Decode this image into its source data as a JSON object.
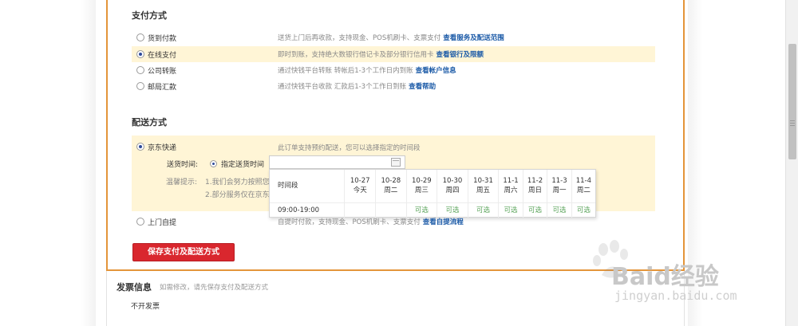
{
  "payment": {
    "title": "支付方式",
    "options": [
      {
        "label": "货到付款",
        "desc": "送货上门后再收款，支持现金、POS机刷卡、支票支付",
        "link": "查看服务及配送范围",
        "selected": false
      },
      {
        "label": "在线支付",
        "desc": "即时到账，支持绝大数银行借记卡及部分银行信用卡",
        "link": "查看银行及限额",
        "selected": true
      },
      {
        "label": "公司转账",
        "desc": "通过快钱平台转账 转帐后1-3个工作日内到账",
        "link": "查看帐户信息",
        "selected": false
      },
      {
        "label": "邮局汇款",
        "desc": "通过快钱平台收款 汇款后1-3个工作日到账",
        "link": "查看帮助",
        "selected": false
      }
    ]
  },
  "shipping": {
    "title": "配送方式",
    "jd": {
      "label": "京东快递",
      "desc": "此订单支持预约配送，您可以选择指定的时间段",
      "selected": true
    },
    "time_label": "送货时间:",
    "time_option": "指定送货时间",
    "tips_label": "温馨提示:",
    "tips": [
      "1.我们会努力按照您",
      "2.部分服务仅在京东"
    ],
    "pickup": {
      "label": "上门自提",
      "desc": "自提时付款，支持现金、POS机刷卡、支票支付",
      "link": "查看自提流程",
      "selected": false
    }
  },
  "calendar": {
    "header_label": "时间段",
    "days": [
      {
        "date": "10-27",
        "weekday": "今天",
        "status": ""
      },
      {
        "date": "10-28",
        "weekday": "周二",
        "status": ""
      },
      {
        "date": "10-29",
        "weekday": "周三",
        "status": "可选"
      },
      {
        "date": "10-30",
        "weekday": "周四",
        "status": "可选"
      },
      {
        "date": "10-31",
        "weekday": "周五",
        "status": "可选"
      },
      {
        "date": "11-1",
        "weekday": "周六",
        "status": "可选"
      },
      {
        "date": "11-2",
        "weekday": "周日",
        "status": "可选"
      },
      {
        "date": "11-3",
        "weekday": "周一",
        "status": "可选"
      },
      {
        "date": "11-4",
        "weekday": "周二",
        "status": "可选"
      }
    ],
    "slot": "09:00-19:00"
  },
  "save_button": "保存支付及配送方式",
  "invoice": {
    "title": "发票信息",
    "note": "如需修改，请先保存支付及配送方式",
    "value": "不开发票"
  },
  "watermark": {
    "brand": "Baid",
    "brand_cn": "经验",
    "url": "jingyan.baidu.com"
  },
  "colors": {
    "accent_border": "#e4953a",
    "selected_bg": "#fff5d6",
    "button": "#d9272e",
    "link": "#1b5aa7",
    "available": "#5aa45a"
  }
}
